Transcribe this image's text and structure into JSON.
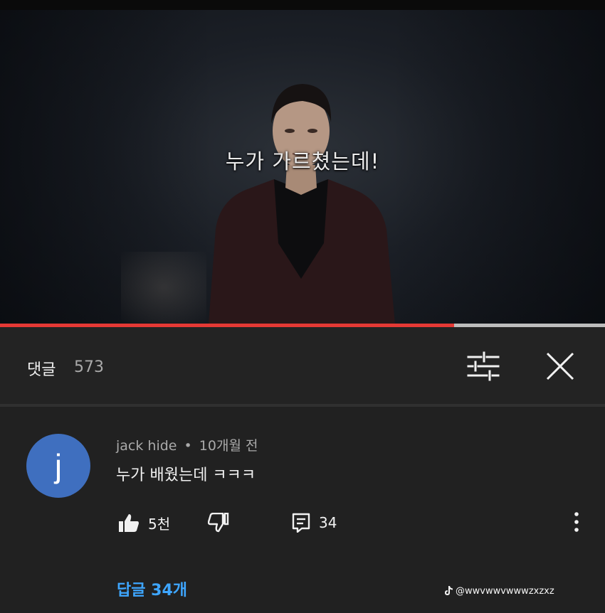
{
  "video": {
    "subtitle": "누가 가르쳤는데!",
    "progress_fraction": 0.75
  },
  "comments_panel": {
    "title": "댓글",
    "count": "573",
    "filter_icon": "sliders-icon",
    "close_icon": "close-icon"
  },
  "comment": {
    "avatar_letter": "j",
    "avatar_color": "#3f6fbf",
    "author": "jack hide",
    "separator": "•",
    "time": "10개월 전",
    "text": "누가 배웠는데 ㅋㅋㅋ",
    "likes": "5천",
    "reply_count": "34",
    "replies_link": "답글 34개",
    "icons": [
      "thumbs-up-icon",
      "thumbs-down-icon",
      "reply-icon",
      "more-vert-icon"
    ]
  },
  "watermark": {
    "icon": "tiktok-icon",
    "handle": "@wwvwwvwwwzxzxz"
  },
  "colors": {
    "background": "#212121",
    "progress": "#e53935",
    "link": "#3ea6ff"
  }
}
